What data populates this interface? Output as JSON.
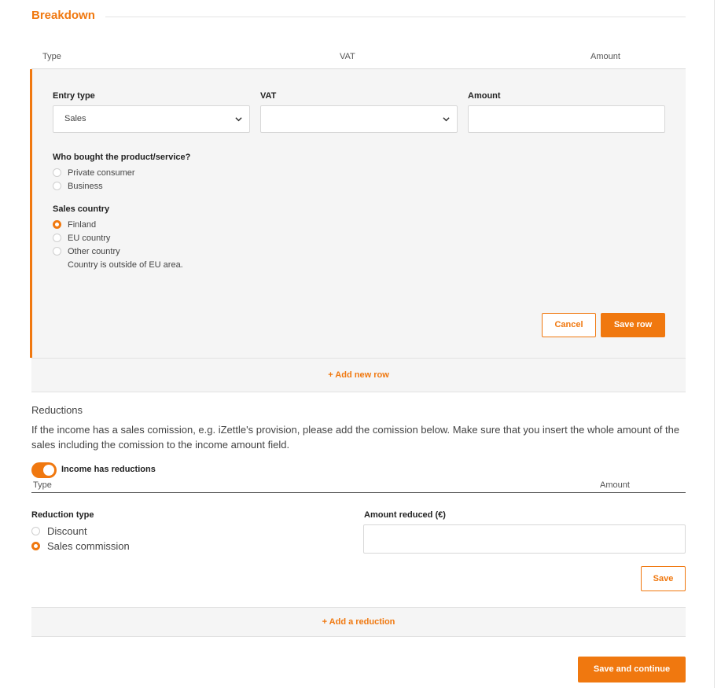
{
  "breakdown": {
    "title": "Breakdown",
    "columns": {
      "type": "Type",
      "vat": "VAT",
      "amount": "Amount"
    },
    "entry": {
      "entry_type_label": "Entry type",
      "entry_type_value": "Sales",
      "vat_label": "VAT",
      "vat_value": "",
      "amount_label": "Amount",
      "amount_value": "",
      "buyer_question": "Who bought the product/service?",
      "buyer_options": [
        "Private consumer",
        "Business"
      ],
      "country_label": "Sales country",
      "country_options": [
        "Finland",
        "EU country",
        "Other country"
      ],
      "country_selected": "Finland",
      "other_country_hint": "Country is outside of EU area.",
      "cancel_label": "Cancel",
      "save_row_label": "Save row"
    },
    "add_row_label": "+ Add new row"
  },
  "reductions": {
    "heading": "Reductions",
    "description": "If the income has a sales comission, e.g. iZettle's provision, please add the comission below. Make sure that you insert the whole amount of the sales including the comission to the income amount field.",
    "toggle_label": "Income has reductions",
    "toggle_on": true,
    "columns": {
      "type": "Type",
      "amount": "Amount"
    },
    "reduction_type_label": "Reduction type",
    "reduction_options": [
      "Discount",
      "Sales commission"
    ],
    "reduction_selected": "Sales commission",
    "amount_reduced_label": "Amount reduced (€)",
    "amount_reduced_value": "",
    "save_label": "Save",
    "add_reduction_label": "+ Add a reduction"
  },
  "footer": {
    "save_continue_label": "Save and continue"
  },
  "colors": {
    "accent": "#f0780f",
    "panel_bg": "#f5f5f5"
  }
}
